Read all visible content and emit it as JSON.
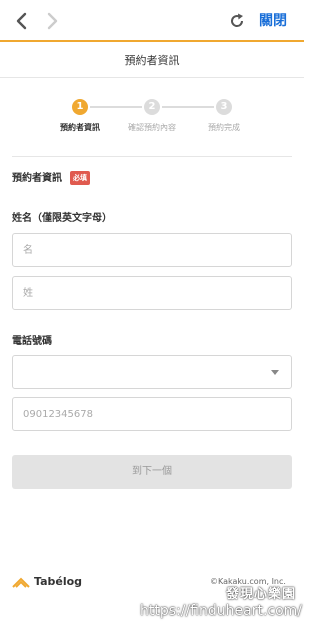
{
  "topbar": {
    "close_label": "關閉",
    "accent_color": "#f0a830"
  },
  "header": {
    "title": "預約者資訊"
  },
  "steps": [
    {
      "number": "1",
      "label": "預約者資訊",
      "active": true
    },
    {
      "number": "2",
      "label": "確認預約內容",
      "active": false
    },
    {
      "number": "3",
      "label": "預約完成",
      "active": false
    }
  ],
  "form": {
    "section_title": "預約者資訊",
    "required_badge": "必填",
    "name_label": "姓名（僅限英文字母）",
    "first_name_placeholder": "名",
    "last_name_placeholder": "姓",
    "phone_label": "電話號碼",
    "country_code_selected": "",
    "phone_placeholder": "09012345678",
    "next_button": "到下一個"
  },
  "footer": {
    "logo_text": "Tabélog",
    "copyright": "©Kakaku.com, Inc."
  },
  "watermark": {
    "name": "發現心樂園",
    "url": "https://finduheart.com/"
  },
  "colors": {
    "active_step": "#f0a830",
    "inactive_step": "#dcdcdc",
    "badge": "#e05a4f",
    "link": "#1a6fd8"
  }
}
